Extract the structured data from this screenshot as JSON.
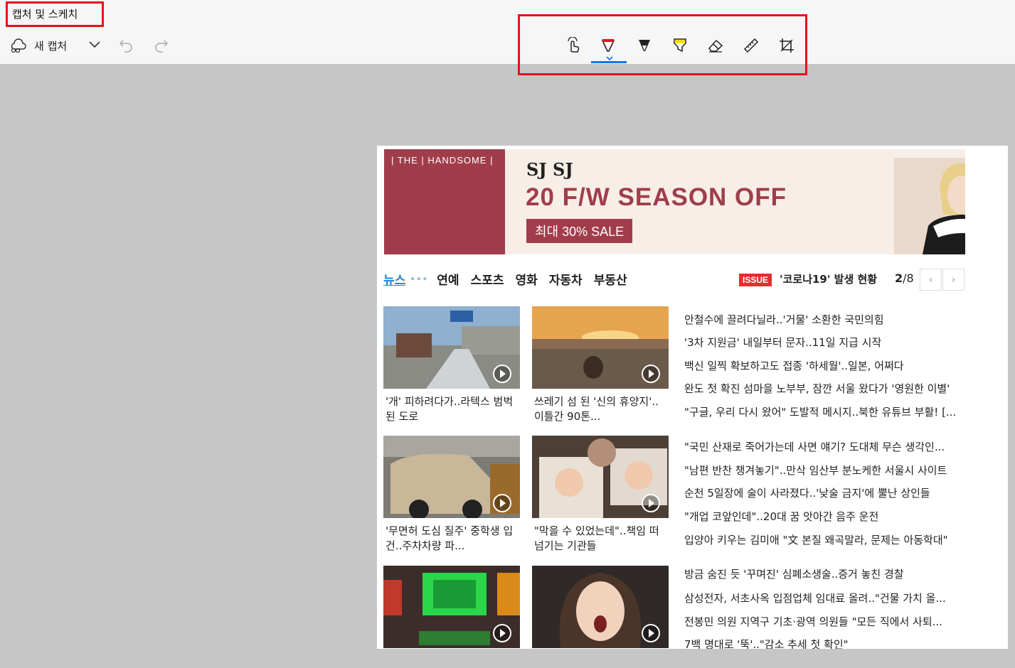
{
  "app": {
    "title": "캡처 및 스케치",
    "new_capture_label": "새 캡처"
  },
  "toolbar": {
    "tools": [
      "touch-writing",
      "ballpoint-pen",
      "pencil",
      "highlighter",
      "eraser",
      "ruler",
      "image-crop"
    ],
    "selected_tool": "ballpoint-pen",
    "colors": {
      "pen": "#e8101e",
      "highlighter": "#f2e200",
      "accent": "#1a73e8",
      "annotation_box": "#e8101e"
    }
  },
  "capture": {
    "banner": {
      "brand": "| THE | HANDSOME |",
      "logo": "SJ SJ",
      "headline": "20 F/W SEASON OFF",
      "sale": "최대 30% SALE"
    },
    "nav": {
      "tabs": [
        "뉴스",
        "연예",
        "스포츠",
        "영화",
        "자동차",
        "부동산"
      ],
      "active_tab": "뉴스",
      "issue_badge": "ISSUE",
      "issue_text": "'코로나19' 발생 현황",
      "page_current": "2",
      "page_total": "/8"
    },
    "thumbs": [
      {
        "caption": "'개' 피하려다가..라텍스 범벅된 도로"
      },
      {
        "caption": "쓰레기 섬 된 '신의 휴양지'..이틀간 90톤..."
      },
      {
        "caption": "'무면허 도심 질주' 중학생 입건..주차차량 파..."
      },
      {
        "caption": "\"막을 수 있었는데\"..책임 떠넘기는 기관들"
      },
      {
        "caption": ""
      },
      {
        "caption": ""
      }
    ],
    "headlines": [
      "안철수에 끌려다닐라..'거물' 소환한 국민의힘",
      "'3차 지원금' 내일부터 문자..11일 지급 시작",
      "백신 일찍 확보하고도 접종 '하세월'..일본, 어쩌다",
      "완도 첫 확진 섬마을 노부부, 잠깐 서울 왔다가 '영원한 이별'",
      "\"구글, 우리 다시 왔어\" 도발적 메시지..북한 유튜브 부활! [...",
      "\"국민 산재로 죽어가는데 사면 얘기? 도대체 무슨 생각인...",
      "\"남편 반찬 챙겨놓기\"..만삭 임산부 분노케한 서울시 사이트",
      "순천 5일장에 술이 사라졌다..'낮술 금지'에 뿔난 상인들",
      "\"개업 코앞인데\"..20대 꿈 앗아간 음주 운전",
      "입양아 키우는 김미애 \"文 본질 왜곡말라, 문제는 아동학대\"",
      "방금 숨진 듯 '꾸며진' 심폐소생술..증거 놓친 경찰",
      "삼성전자, 서초사옥 입점업체 임대료 올려..\"건물 가치 올...",
      "전봉민 의원 지역구 기초·광역 의원들 \"모든 직에서 사퇴...",
      "7백 명대로 '뚝'..\"감소 추세 첫 확인\""
    ]
  }
}
